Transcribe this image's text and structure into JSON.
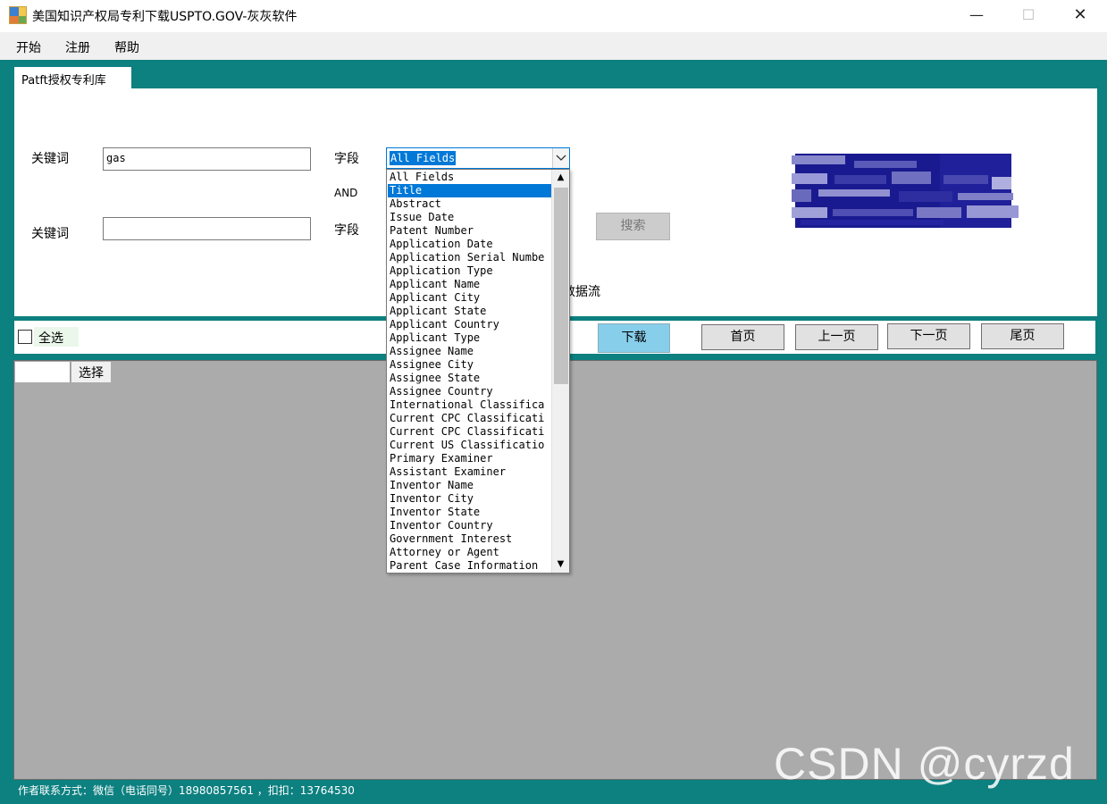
{
  "window": {
    "title": "美国知识产权局专利下载USPTO.GOV-灰灰软件",
    "minimize_glyph": "—",
    "maximize_glyph": "☐",
    "close_glyph": "✕"
  },
  "menu": {
    "items": [
      "开始",
      "注册",
      "帮助"
    ]
  },
  "tab": {
    "label": "Patft授权专利库"
  },
  "search": {
    "keyword1_label": "关键词",
    "keyword1_value": "gas",
    "field1_label": "字段",
    "field1_selected": "All Fields",
    "operator_label": "AND",
    "keyword2_label": "关键词",
    "keyword2_value": "",
    "field2_label": "字段",
    "search_button": "搜索",
    "stream_text": "数据流"
  },
  "dropdown": {
    "highlighted": "Title",
    "options": [
      "All Fields",
      "Title",
      "Abstract",
      "Issue Date",
      "Patent Number",
      "Application Date",
      "Application Serial Numbe",
      "Application Type",
      "Applicant Name",
      "Applicant City",
      "Applicant State",
      "Applicant Country",
      "Applicant Type",
      "Assignee Name",
      "Assignee City",
      "Assignee State",
      "Assignee Country",
      "International Classifica",
      "Current CPC Classificati",
      "Current CPC Classificati",
      "Current US Classificatio",
      "Primary Examiner",
      "Assistant Examiner",
      "Inventor Name",
      "Inventor City",
      "Inventor State",
      "Inventor Country",
      "Government Interest",
      "Attorney or Agent",
      "Parent Case Information"
    ],
    "scroll_up_glyph": "▲",
    "scroll_down_glyph": "▼"
  },
  "toolbar": {
    "select_all_label": "全选",
    "download_button": "下载",
    "first_page": "首页",
    "prev_page": "上一页",
    "next_page": "下一页",
    "last_page": "尾页"
  },
  "grid": {
    "columns": [
      "",
      "选择"
    ]
  },
  "watermark": "CSDN @cyrzd",
  "footer": "作者联系方式：微信（电话同号）18980857561 ，扣扣：13764530",
  "colors": {
    "frame": "#0d8080",
    "selection": "#0078d7",
    "download_button": "#87ceeb",
    "grid_background": "#ababab"
  }
}
